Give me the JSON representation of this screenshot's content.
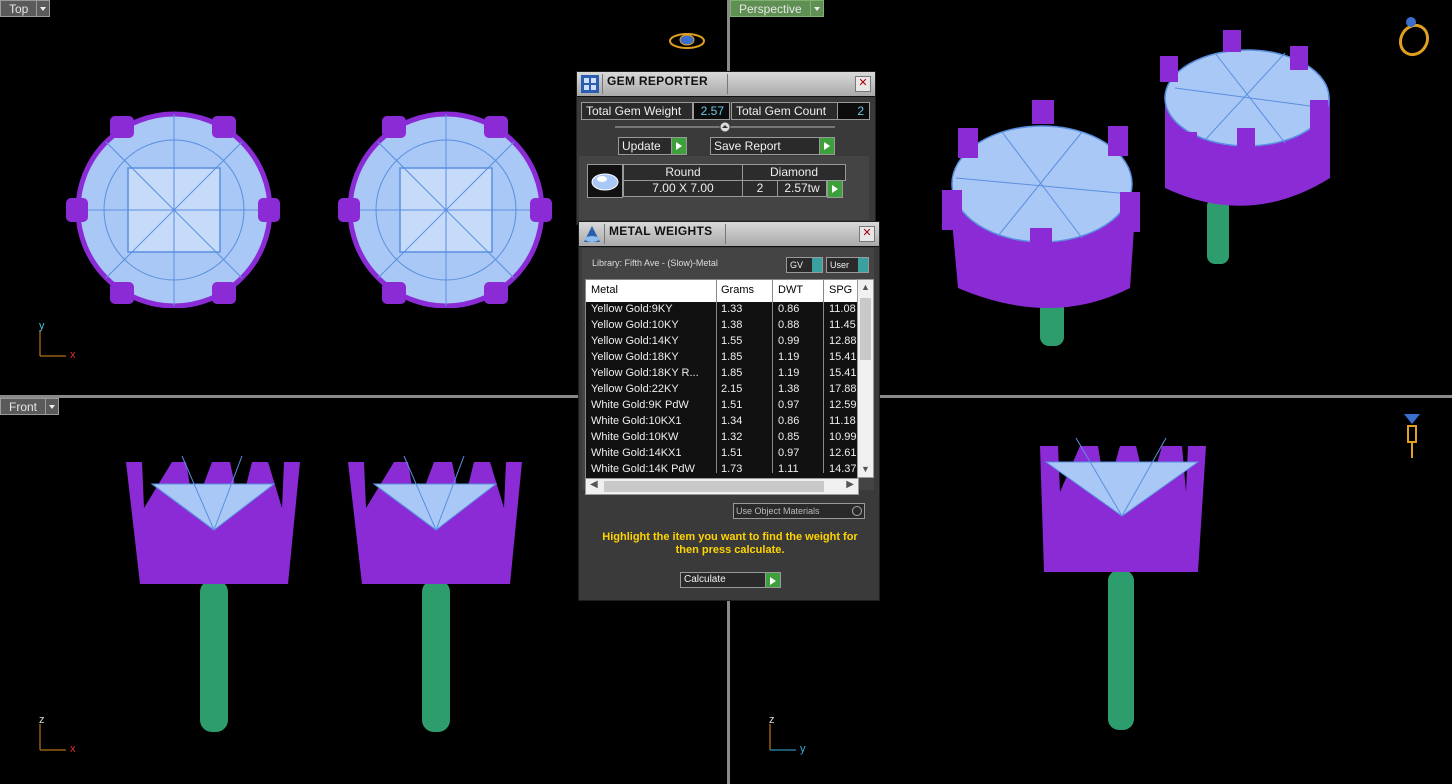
{
  "viewports": {
    "top": {
      "label": "Top",
      "axis_v": "y",
      "axis_h": "x"
    },
    "perspective": {
      "label": "Perspective"
    },
    "front": {
      "label": "Front",
      "axis_v": "z",
      "axis_h": "x"
    },
    "right": {
      "axis_v": "z",
      "axis_h": "y"
    }
  },
  "gem_reporter": {
    "title": "GEM REPORTER",
    "total_weight_label": "Total Gem Weight",
    "total_weight_value": "2.57",
    "total_count_label": "Total Gem Count",
    "total_count_value": "2",
    "update_label": "Update",
    "save_report_label": "Save Report",
    "gem": {
      "shape": "Round",
      "material": "Diamond",
      "size": "7.00 X 7.00",
      "count": "2",
      "weight": "2.57tw"
    }
  },
  "metal_weights": {
    "title": "METAL WEIGHTS",
    "library": "Library: Fifth Ave - (Slow)-Metal",
    "gv_label": "GV",
    "user_label": "User",
    "columns": [
      "Metal",
      "Grams",
      "DWT",
      "SPG"
    ],
    "rows": [
      [
        "Yellow Gold:9KY",
        "1.33",
        "0.86",
        "11.08"
      ],
      [
        "Yellow Gold:10KY",
        "1.38",
        "0.88",
        "11.45"
      ],
      [
        "Yellow Gold:14KY",
        "1.55",
        "0.99",
        "12.88"
      ],
      [
        "Yellow Gold:18KY",
        "1.85",
        "1.19",
        "15.41"
      ],
      [
        "Yellow Gold:18KY R...",
        "1.85",
        "1.19",
        "15.41"
      ],
      [
        "Yellow Gold:22KY",
        "2.15",
        "1.38",
        "17.88"
      ],
      [
        "White Gold:9K PdW",
        "1.51",
        "0.97",
        "12.59"
      ],
      [
        "White Gold:10KX1",
        "1.34",
        "0.86",
        "11.18"
      ],
      [
        "White Gold:10KW",
        "1.32",
        "0.85",
        "10.99"
      ],
      [
        "White Gold:14KX1",
        "1.51",
        "0.97",
        "12.61"
      ],
      [
        "White Gold:14K PdW",
        "1.73",
        "1.11",
        "14.37"
      ]
    ],
    "use_object_materials": "Use Object Materials",
    "hint": "Highlight the item you want to find the weight for then press calculate.",
    "calculate_label": "Calculate"
  },
  "colors": {
    "prong": "#8a2bd6",
    "gem_fill": "#a9c8f5",
    "gem_wire": "#5a8fe0",
    "post": "#2e9d6e",
    "accent_text": "#ffd400"
  }
}
